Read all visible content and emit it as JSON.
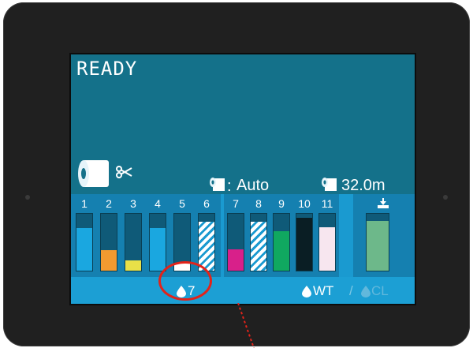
{
  "screen": {
    "status": "READY",
    "icons": {
      "roll": "paper-roll-icon",
      "cutter": "scissors-icon",
      "media_type": "paper-sheet-icon",
      "remaining": "paper-sheet-icon",
      "maintenance": "maintenance-box-icon",
      "drop": "ink-drop-icon"
    },
    "media": {
      "separator": ":",
      "mode": "Auto",
      "remaining": "32.0m"
    },
    "ink_slots": [
      {
        "label": "1",
        "color": "#1aa7e0",
        "level": 0.75,
        "striped": false
      },
      {
        "label": "2",
        "color": "#f29a30",
        "level": 0.36,
        "striped": false
      },
      {
        "label": "3",
        "color": "#e8e048",
        "level": 0.18,
        "striped": false
      },
      {
        "label": "4",
        "color": "#1aa7e0",
        "level": 0.75,
        "striped": false
      },
      {
        "label": "5",
        "color": "#ffffff",
        "level": 0.12,
        "striped": false
      },
      {
        "label": "6",
        "color": "#ffffff",
        "level": 0.86,
        "striped": true
      },
      {
        "label": "7",
        "color": "#d8208a",
        "level": 0.38,
        "striped": false
      },
      {
        "label": "8",
        "color": "#ffffff",
        "level": 0.86,
        "striped": true
      },
      {
        "label": "9",
        "color": "#10a860",
        "level": 0.7,
        "striped": false
      },
      {
        "label": "10",
        "color": "#0a1e24",
        "level": 0.93,
        "striped": false
      },
      {
        "label": "11",
        "color": "#f7e6ef",
        "level": 0.77,
        "striped": false
      }
    ],
    "maintenance_box": {
      "color": "#6db88a",
      "level": 0.88
    },
    "bottom_bar": {
      "drop_count": "7",
      "wt_label": "WT",
      "slash": "/",
      "cl_label": "CL"
    }
  },
  "annotation": {
    "color": "#e2231a"
  }
}
